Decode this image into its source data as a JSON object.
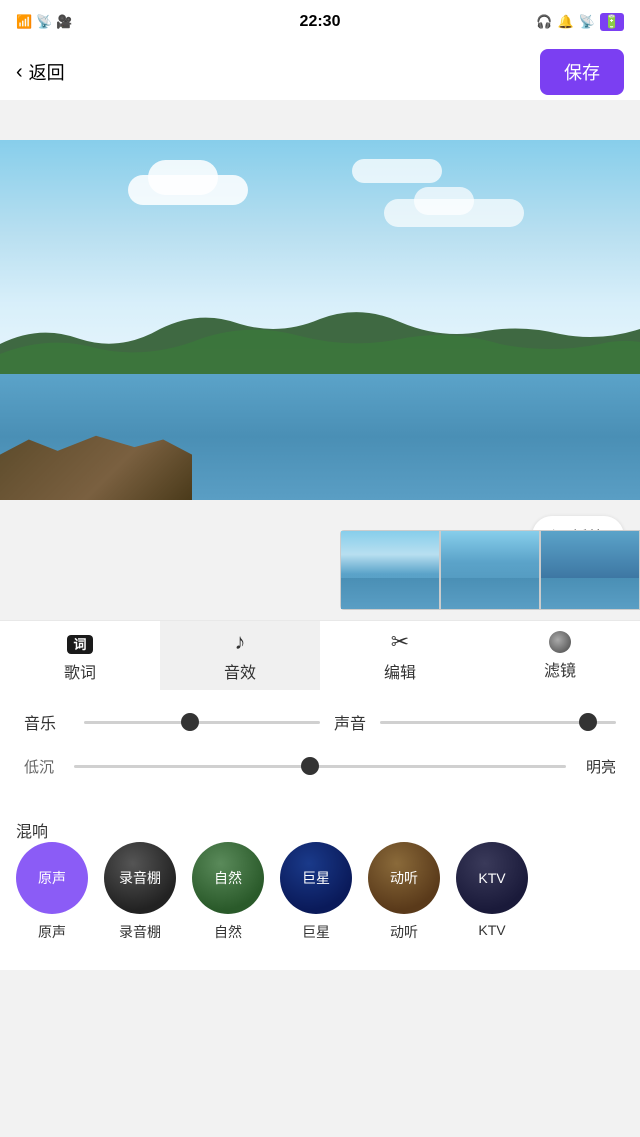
{
  "statusBar": {
    "signal": "📶",
    "wifi": "WiFi",
    "time": "22:30",
    "battery": "🔋"
  },
  "nav": {
    "backLabel": "返回",
    "saveLabel": "保存"
  },
  "preview": {
    "playLabel": "▶ 播放"
  },
  "tabs": [
    {
      "id": "lyrics",
      "icon": "词",
      "label": "歌词",
      "active": false
    },
    {
      "id": "effects",
      "icon": "♪",
      "label": "音效",
      "active": true
    },
    {
      "id": "edit",
      "icon": "✂",
      "label": "编辑",
      "active": false
    },
    {
      "id": "filter",
      "icon": "●",
      "label": "滤镜",
      "active": false
    }
  ],
  "sliders": {
    "music": {
      "label": "音乐",
      "value": 45,
      "thumbPercent": 45
    },
    "sound": {
      "label": "声音",
      "value": 88,
      "thumbPercent": 88
    }
  },
  "brightness": {
    "leftLabel": "低沉",
    "rightLabel": "明亮",
    "thumbPercent": 48
  },
  "reverb": {
    "label": "混响",
    "options": [
      {
        "id": "original",
        "name": "原声",
        "colorClass": "rb-original",
        "active": true
      },
      {
        "id": "studio",
        "name": "录音棚",
        "colorClass": "rb-studio",
        "active": false
      },
      {
        "id": "nature",
        "name": "自然",
        "colorClass": "rb-nature",
        "active": false
      },
      {
        "id": "giant",
        "name": "巨星",
        "colorClass": "rb-giant",
        "active": false
      },
      {
        "id": "moving",
        "name": "动听",
        "colorClass": "rb-moving",
        "active": false
      },
      {
        "id": "ktv",
        "name": "KTV",
        "colorClass": "rb-ktv",
        "active": false
      }
    ]
  }
}
